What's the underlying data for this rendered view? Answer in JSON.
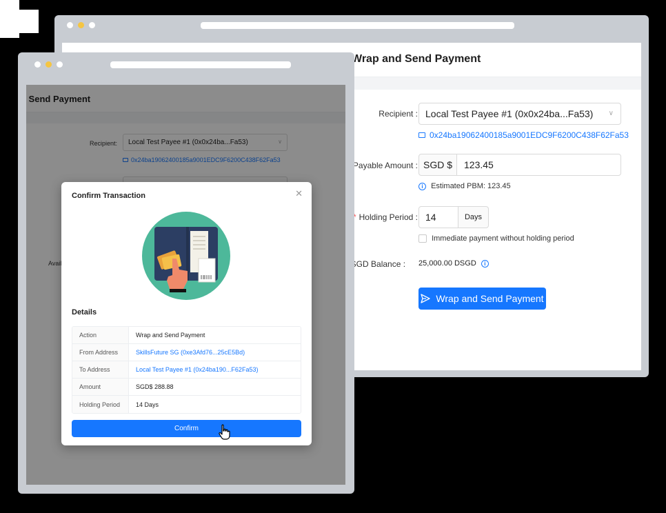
{
  "back_window": {
    "title": "Wrap and Send Payment",
    "recipient_label": "Recipient",
    "recipient_value": "Local Test Payee #1 (0x0x24ba...Fa53)",
    "recipient_address": "0x24ba19062400185a9001EDC9F6200C438F62Fa53",
    "payable_label": "Payable Amount",
    "currency": "SGD $",
    "amount": "123.45",
    "estimated_pbm": "Estimated PBM: 123.45",
    "holding_label": "Holding Period",
    "holding_value": "14",
    "holding_unit": "Days",
    "immediate_label": "Immediate payment without holding period",
    "balance_label": "e DSGD Balance",
    "balance_value": "25,000.00 DSGD",
    "submit_label": "Wrap and Send Payment"
  },
  "front_window": {
    "title": "d Send Payment",
    "recipient_label": "Recipient:",
    "recipient_value": "Local Test Payee #1 (0x0x24ba...Fa53)",
    "recipient_address": "0x24ba19062400185a9001EDC9F6200C438F62Fa53",
    "partial_label": "Avail"
  },
  "modal": {
    "title": "Confirm Transaction",
    "details_heading": "Details",
    "rows": [
      {
        "key": "Action",
        "value": "Wrap and Send Payment"
      },
      {
        "key": "From Address",
        "value": "SkillsFuture SG (0xe3Afd76...25cE5Bd)"
      },
      {
        "key": "To Address",
        "value": "Local Test Payee #1 (0x24ba190...F62Fa53)"
      },
      {
        "key": "Amount",
        "value": "SGD$ 288.88"
      },
      {
        "key": "Holding Period",
        "value": "14 Days"
      }
    ],
    "confirm_label": "Confirm"
  },
  "colors": {
    "primary": "#1677ff",
    "illustration_bg": "#4db89a",
    "card_dark": "#2c3e63"
  }
}
